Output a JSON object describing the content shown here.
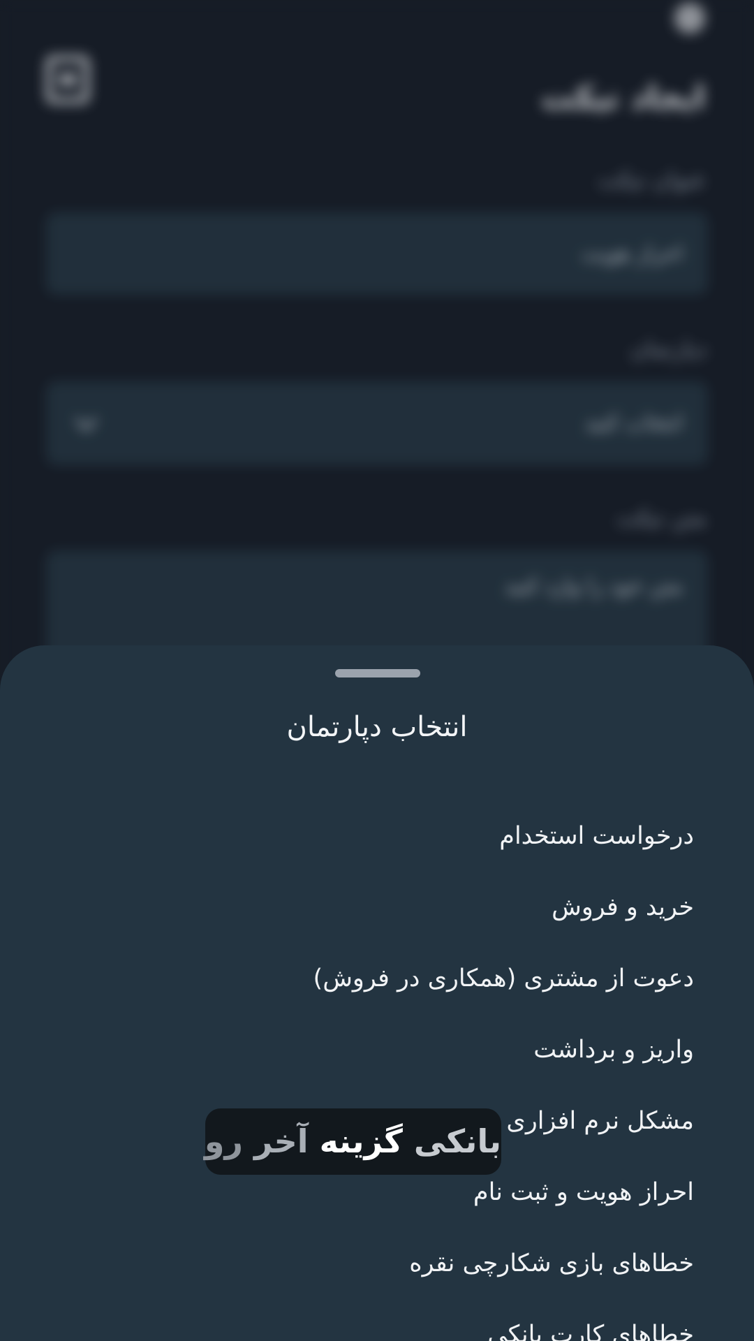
{
  "background_form": {
    "title": "ایجاد تیکت",
    "fields": [
      {
        "label": "عنوان تیکت",
        "value": "احراز هویت"
      },
      {
        "label": "دپارتمان",
        "value": "انتخاب کنید"
      },
      {
        "label": "متن تیکت",
        "value": "متن خود را وارد کنید"
      }
    ]
  },
  "sheet": {
    "title": "انتخاب دپارتمان",
    "options": [
      "درخواست استخدام",
      "خرید و فروش",
      "دعوت از مشتری (همکاری در فروش)",
      "واریز و برداشت",
      "مشکل نرم افزاری",
      "احراز هویت و ثبت نام",
      "خطاهای بازی شکارچی نقره",
      "خطاهای کارت بانکی"
    ]
  },
  "caption": {
    "words": [
      "بانکی",
      "گزینه",
      "آخر",
      "رو"
    ]
  }
}
